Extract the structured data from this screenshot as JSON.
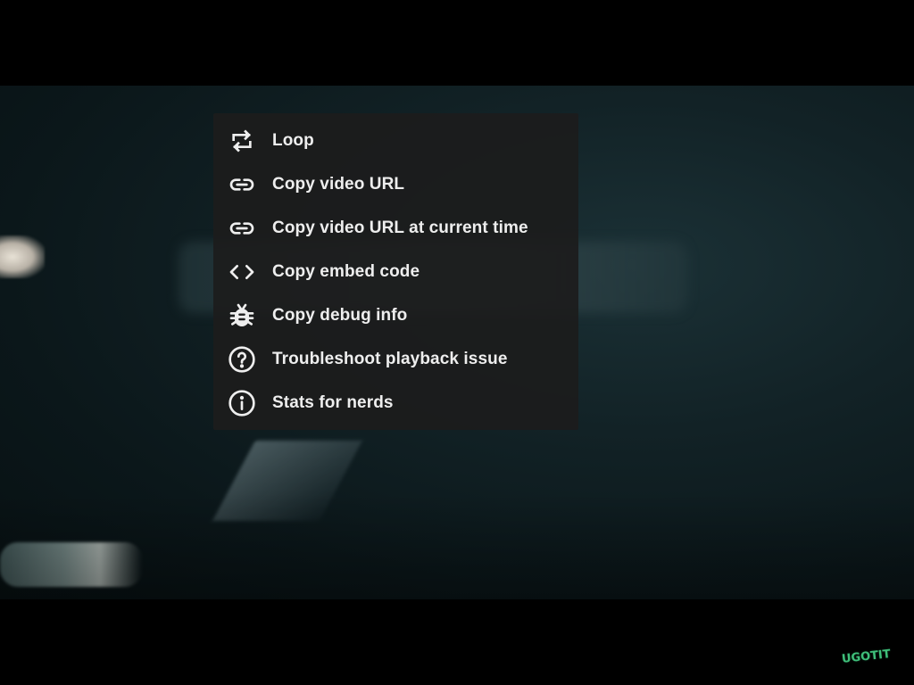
{
  "context_menu": {
    "items": [
      {
        "label": "Loop",
        "icon": "loop-icon"
      },
      {
        "label": "Copy video URL",
        "icon": "link-icon"
      },
      {
        "label": "Copy video URL at current time",
        "icon": "link-icon"
      },
      {
        "label": "Copy embed code",
        "icon": "code-icon"
      },
      {
        "label": "Copy debug info",
        "icon": "bug-icon"
      },
      {
        "label": "Troubleshoot playback issue",
        "icon": "help-circle-icon"
      },
      {
        "label": "Stats for nerds",
        "icon": "info-circle-icon"
      }
    ]
  },
  "watermark": {
    "text": "UGOTIT",
    "color": "#3fbf7a"
  },
  "colors": {
    "menu_background": "#1c1c1c",
    "menu_text": "#eeeeee",
    "letterbox": "#000000"
  }
}
